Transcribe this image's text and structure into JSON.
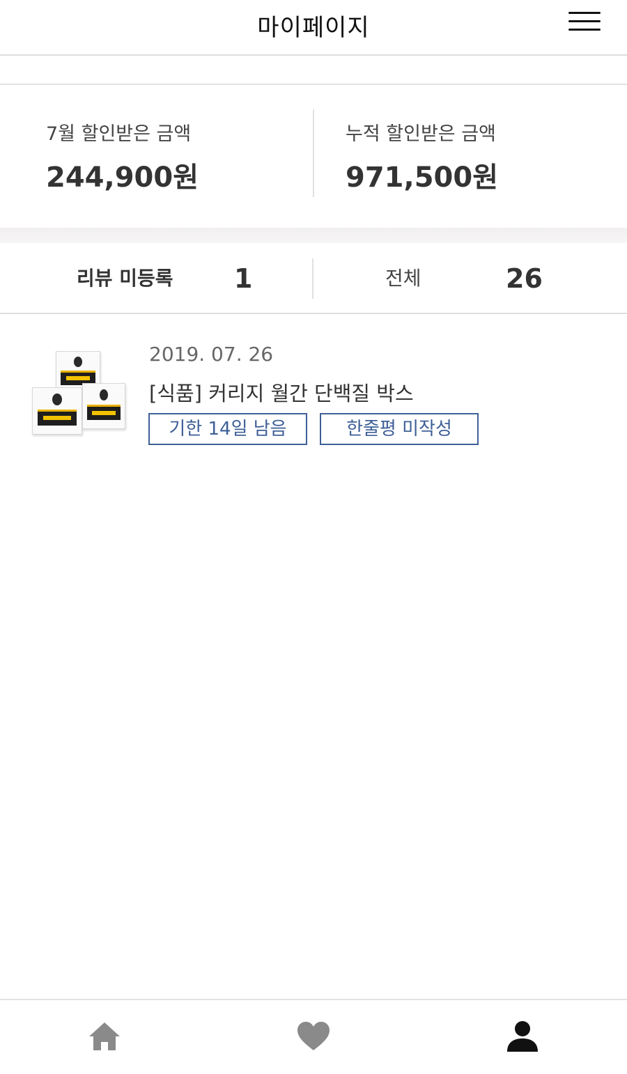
{
  "header": {
    "title": "마이페이지",
    "menu_icon": "hamburger-menu-icon"
  },
  "discount": {
    "month_label": "7월 할인받은 금액",
    "month_amount": "244,900원",
    "total_label": "누적 할인받은 금액",
    "total_amount": "971,500원"
  },
  "reviews": {
    "unregistered_label": "리뷰 미등록",
    "unregistered_count": "1",
    "total_label": "전체",
    "total_count": "26"
  },
  "orders": [
    {
      "date": "2019. 07. 26",
      "name": "[식품] 커리지 월간 단백질 박스",
      "deadline_tag": "기한 14일 남음",
      "review_tag": "한줄평 미작성",
      "thumbnail_icon": "protein-box-product-image"
    }
  ],
  "bottom_nav": {
    "items": [
      {
        "icon": "home-icon",
        "color": "#8a8a8a"
      },
      {
        "icon": "heart-icon",
        "color": "#8a8a8a"
      },
      {
        "icon": "person-icon",
        "color": "#111111"
      }
    ]
  },
  "colors": {
    "tag_border": "#3e5f97",
    "divider": "#e2e2e2"
  }
}
